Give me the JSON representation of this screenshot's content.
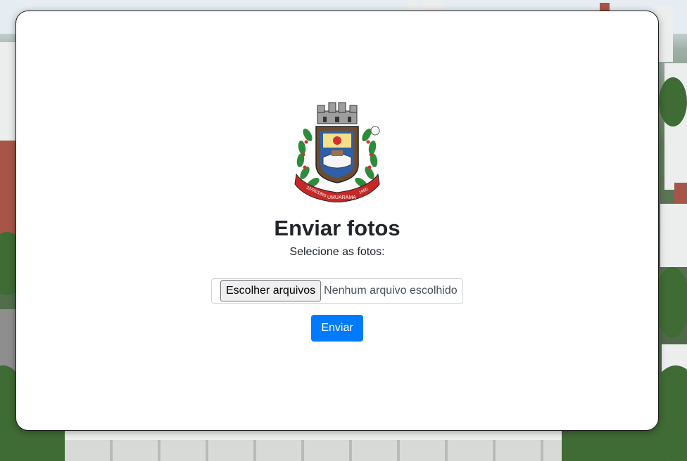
{
  "page": {
    "title": "Enviar fotos",
    "subtitle": "Selecione as fotos:"
  },
  "logo": {
    "icon": "municipal-coat-of-arms-icon",
    "banner_left": "22/06/1955",
    "banner_center": "UMUARAMA",
    "banner_right": "1960"
  },
  "form": {
    "file_button_label": "Escolher arquivos",
    "file_status": "Nenhum arquivo escolhido",
    "submit_label": "Enviar"
  },
  "colors": {
    "primary": "#007bff",
    "card_background": "#ffffff",
    "text": "#212529"
  }
}
